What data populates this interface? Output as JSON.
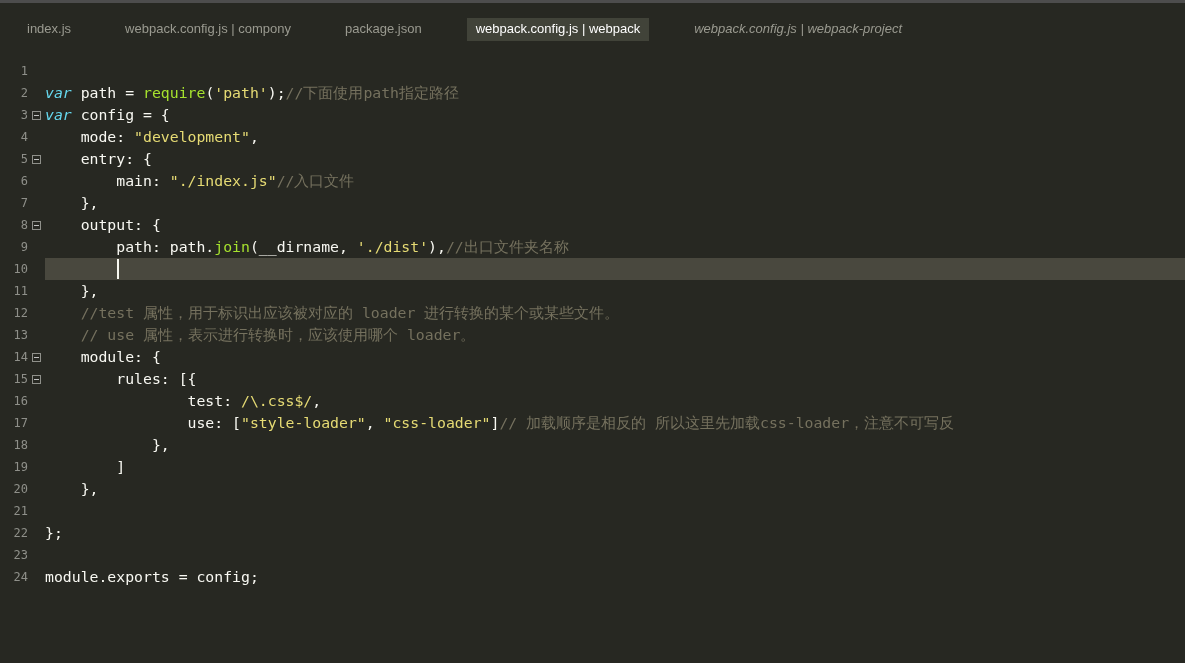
{
  "tabs": [
    {
      "label": "index.js",
      "selected": false,
      "preview": false
    },
    {
      "label": "webpack.config.js | compony",
      "selected": false,
      "preview": false
    },
    {
      "label": "package.json",
      "selected": false,
      "preview": false
    },
    {
      "label": "webpack.config.js | webpack",
      "selected": true,
      "preview": false
    },
    {
      "label": "webpack.config.js | webpack-project",
      "selected": false,
      "preview": true
    }
  ],
  "editor": {
    "lines": [
      {
        "number": "1",
        "foldable": false,
        "current": false
      },
      {
        "number": "2",
        "foldable": false,
        "current": false,
        "tokens": [
          {
            "kind": "keyword",
            "text": "var"
          },
          {
            "kind": "plain",
            "text": " path = "
          },
          {
            "kind": "function",
            "text": "require"
          },
          {
            "kind": "plain",
            "text": "("
          },
          {
            "kind": "string",
            "text": "'path'"
          },
          {
            "kind": "plain",
            "text": ");"
          },
          {
            "kind": "comment",
            "text": "//下面使用path指定路径"
          }
        ]
      },
      {
        "number": "3",
        "foldable": true,
        "current": false,
        "tokens": [
          {
            "kind": "keyword",
            "text": "var"
          },
          {
            "kind": "plain",
            "text": " config = {"
          }
        ]
      },
      {
        "number": "4",
        "foldable": false,
        "current": false,
        "tokens": [
          {
            "kind": "plain",
            "text": "    mode: "
          },
          {
            "kind": "string",
            "text": "\"development\""
          },
          {
            "kind": "plain",
            "text": ","
          }
        ]
      },
      {
        "number": "5",
        "foldable": true,
        "current": false,
        "tokens": [
          {
            "kind": "plain",
            "text": "    entry: {"
          }
        ]
      },
      {
        "number": "6",
        "foldable": false,
        "current": false,
        "tokens": [
          {
            "kind": "plain",
            "text": "        main: "
          },
          {
            "kind": "string",
            "text": "\"./index.js\""
          },
          {
            "kind": "comment",
            "text": "//入口文件"
          }
        ]
      },
      {
        "number": "7",
        "foldable": false,
        "current": false,
        "tokens": [
          {
            "kind": "plain",
            "text": "    },"
          }
        ]
      },
      {
        "number": "8",
        "foldable": true,
        "current": false,
        "tokens": [
          {
            "kind": "plain",
            "text": "    output: {"
          }
        ]
      },
      {
        "number": "9",
        "foldable": false,
        "current": false,
        "tokens": [
          {
            "kind": "plain",
            "text": "        path: path."
          },
          {
            "kind": "function",
            "text": "join"
          },
          {
            "kind": "plain",
            "text": "(__dirname, "
          },
          {
            "kind": "string",
            "text": "'./dist'"
          },
          {
            "kind": "plain",
            "text": "),"
          },
          {
            "kind": "comment",
            "text": "//出口文件夹名称"
          }
        ]
      },
      {
        "number": "10",
        "foldable": false,
        "current": true
      },
      {
        "number": "11",
        "foldable": false,
        "current": false,
        "tokens": [
          {
            "kind": "plain",
            "text": "    },"
          }
        ]
      },
      {
        "number": "12",
        "foldable": false,
        "current": false,
        "tokens": [
          {
            "kind": "comment",
            "text": "    //test 属性，用于标识出应该被对应的 loader 进行转换的某个或某些文件。"
          }
        ]
      },
      {
        "number": "13",
        "foldable": false,
        "current": false,
        "tokens": [
          {
            "kind": "comment",
            "text": "    // use 属性，表示进行转换时，应该使用哪个 loader。"
          }
        ]
      },
      {
        "number": "14",
        "foldable": true,
        "current": false,
        "tokens": [
          {
            "kind": "plain",
            "text": "    module: {"
          }
        ]
      },
      {
        "number": "15",
        "foldable": true,
        "current": false,
        "tokens": [
          {
            "kind": "plain",
            "text": "        rules: [{"
          }
        ]
      },
      {
        "number": "16",
        "foldable": false,
        "current": false,
        "tokens": [
          {
            "kind": "plain",
            "text": "                test: "
          },
          {
            "kind": "string",
            "text": "/\\.css$/"
          },
          {
            "kind": "plain",
            "text": ","
          }
        ]
      },
      {
        "number": "17",
        "foldable": false,
        "current": false,
        "tokens": [
          {
            "kind": "plain",
            "text": "                use: ["
          },
          {
            "kind": "string",
            "text": "\"style-loader\""
          },
          {
            "kind": "plain",
            "text": ", "
          },
          {
            "kind": "string",
            "text": "\"css-loader\""
          },
          {
            "kind": "plain",
            "text": "]"
          },
          {
            "kind": "comment",
            "text": "// 加载顺序是相反的 所以这里先加载css-loader，注意不可写反"
          }
        ]
      },
      {
        "number": "18",
        "foldable": false,
        "current": false,
        "tokens": [
          {
            "kind": "plain",
            "text": "            },"
          }
        ]
      },
      {
        "number": "19",
        "foldable": false,
        "current": false,
        "tokens": [
          {
            "kind": "plain",
            "text": "        ]"
          }
        ]
      },
      {
        "number": "20",
        "foldable": false,
        "current": false,
        "tokens": [
          {
            "kind": "plain",
            "text": "    },"
          }
        ]
      },
      {
        "number": "21",
        "foldable": false,
        "current": false
      },
      {
        "number": "22",
        "foldable": false,
        "current": false,
        "tokens": [
          {
            "kind": "plain",
            "text": "};"
          }
        ]
      },
      {
        "number": "23",
        "foldable": false,
        "current": false
      },
      {
        "number": "24",
        "foldable": false,
        "current": false,
        "tokens": [
          {
            "kind": "plain",
            "text": "module.exports = config;"
          }
        ]
      }
    ]
  }
}
